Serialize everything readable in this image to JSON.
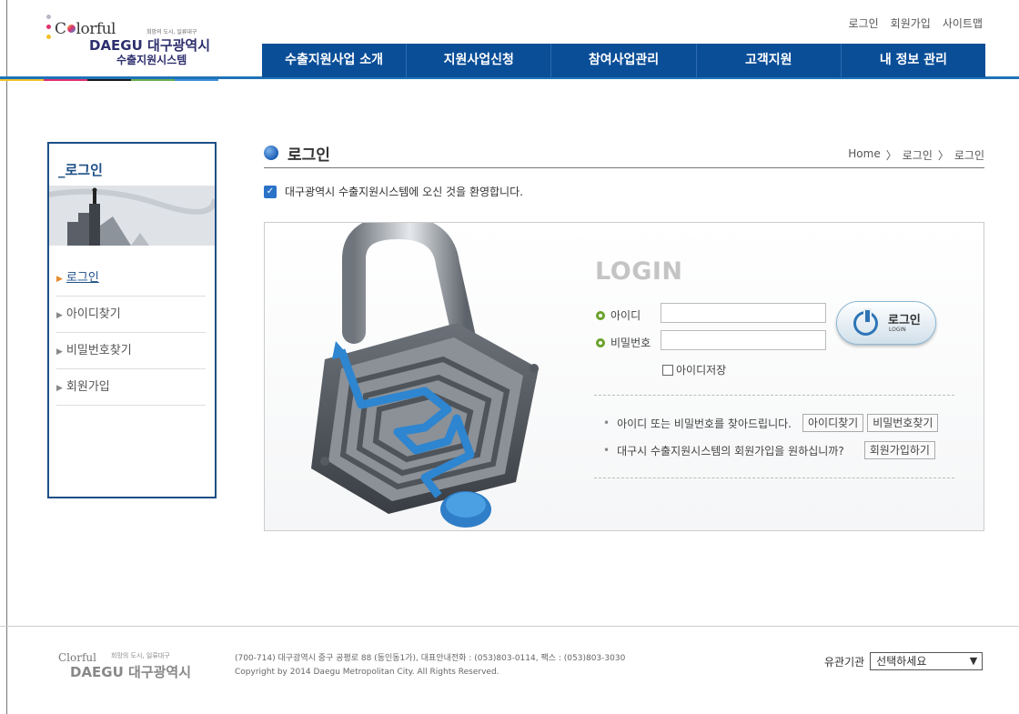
{
  "header": {
    "logo": {
      "colorful": "Clorful",
      "tagline": "희망의 도시, 일류대구",
      "daegu": "DAEGU 대구광역시",
      "system": "수출지원시스템"
    },
    "utility": [
      "로그인",
      "회원가입",
      "사이트맵"
    ],
    "menu": [
      "수출지원사업 소개",
      "지원사업신청",
      "참여사업관리",
      "고객지원",
      "내 정보 관리"
    ],
    "colors": {
      "navy": "#0a4e98",
      "accent_line": "#1e73b8"
    }
  },
  "sidebar": {
    "title": "_로그인",
    "items": [
      {
        "label": "로그인",
        "active": true
      },
      {
        "label": "아이디찾기",
        "active": false
      },
      {
        "label": "비밀번호찾기",
        "active": false
      },
      {
        "label": "회원가입",
        "active": false
      }
    ]
  },
  "content": {
    "title": "로그인",
    "breadcrumb": [
      "Home",
      "로그인",
      "로그인"
    ],
    "breadcrumb_sep": "〉",
    "welcome": "대구광역시 수출지원시스템에 오신 것을 환영합니다.",
    "login": {
      "heading": "LOGIN",
      "id_label": "아이디",
      "pw_label": "비밀번호",
      "id_value": "",
      "pw_value": "",
      "save_id_label": "아이디저장",
      "button_label": "로그인",
      "button_sub": "LOGIN",
      "help": [
        {
          "text": "아이디 또는 비밀번호를 찾아드립니다.",
          "buttons": [
            "아이디찾기",
            "비밀번호찾기"
          ]
        },
        {
          "text": "대구시 수출지원시스템의 회원가입을 원하십니까?",
          "buttons": [
            "회원가입하기"
          ]
        }
      ]
    }
  },
  "footer": {
    "logo": {
      "colorful": "Clorful",
      "tagline": "희망의 도시, 일류대구",
      "daegu": "DAEGU 대구광역시"
    },
    "address": "(700-714) 대구광역시 중구 공평로 88 (동인동1가), 대표안내전화 : (053)803-0114, 팩스 : (053)803-3030",
    "copyright": "Copyright by 2014 Daegu Metropolitan City. All Rights Reserved.",
    "related_label": "유관기관",
    "related_select": "선택하세요"
  }
}
